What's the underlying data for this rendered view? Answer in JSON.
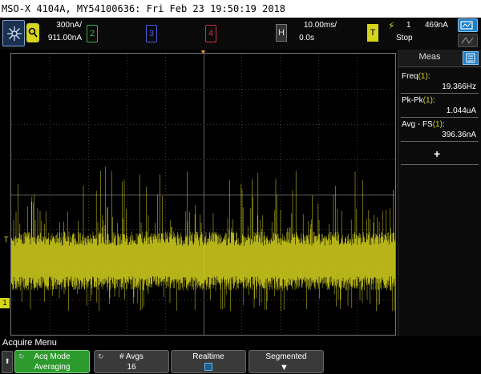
{
  "title_bar": {
    "text": "MSO-X 4104A, MY54100636: Fri Feb 23 19:50:19 2018"
  },
  "channels": {
    "ch1": {
      "label": "1",
      "scale": "300nA/",
      "offset": "911.00nA",
      "color": "#d6d41c"
    },
    "ch2": {
      "label": "2",
      "color": "#3bb14a"
    },
    "ch3": {
      "label": "3",
      "color": "#4c5de0"
    },
    "ch4": {
      "label": "4",
      "color": "#d0304a"
    }
  },
  "horizontal": {
    "label": "H",
    "timebase": "10.00ms/",
    "delay": "0.0s"
  },
  "trigger": {
    "label": "T",
    "source": "1",
    "level": "469nA",
    "run_state": "Stop"
  },
  "waveform": {
    "channel": "1",
    "color": "#d6d41c",
    "markers": {
      "trigger_level": "T",
      "ground": "1"
    }
  },
  "meas": {
    "title": "Meas",
    "items": [
      {
        "name": "Freq",
        "channel": "(1)",
        "suffix": ":",
        "value": "19.366Hz"
      },
      {
        "name": "Pk-Pk",
        "channel": "(1)",
        "suffix": ":",
        "value": "1.044uA"
      },
      {
        "name": "Avg - FS",
        "channel": "(1)",
        "suffix": ":",
        "value": "396.36nA"
      }
    ],
    "add_label": "+"
  },
  "menu": {
    "title": "Acquire Menu",
    "back": "⬆",
    "softkeys": [
      {
        "label": "Acq Mode",
        "value": "Averaging"
      },
      {
        "label": "# Avgs",
        "value": "16"
      },
      {
        "label": "Realtime",
        "value": ""
      },
      {
        "label": "Segmented",
        "value": ""
      }
    ]
  }
}
